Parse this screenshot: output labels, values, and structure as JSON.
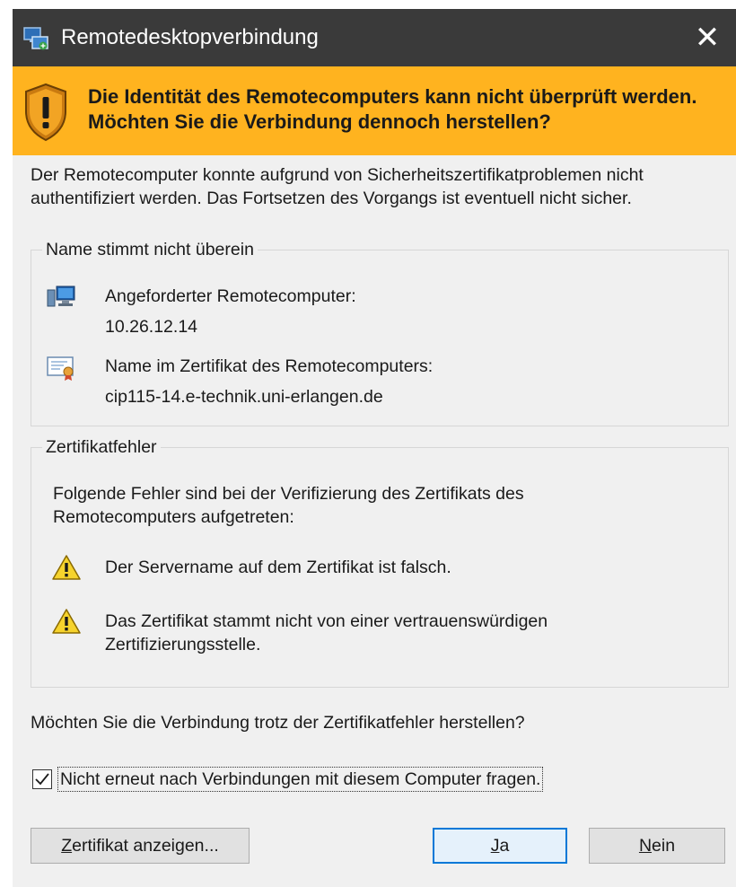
{
  "window": {
    "title": "Remotedesktopverbindung",
    "close_glyph": "✕"
  },
  "banner": {
    "text": "Die Identität des Remotecomputers kann nicht überprüft werden. Möchten Sie die Verbindung dennoch herstellen?",
    "color": "#ffb31f",
    "icon": "shield-warning-icon"
  },
  "intro": "Der Remotecomputer konnte aufgrund von Sicherheitszertifikatproblemen nicht authentifiziert werden. Das Fortsetzen des Vorgangs ist eventuell nicht sicher.",
  "name_mismatch": {
    "legend": "Name stimmt nicht überein",
    "requested_label": "Angeforderter Remotecomputer:",
    "requested_value": "10.26.12.14",
    "cert_label": "Name im Zertifikat des Remotecomputers:",
    "cert_value": "cip115-14.e-technik.uni-erlangen.de"
  },
  "cert_errors": {
    "legend": "Zertifikatfehler",
    "description": "Folgende Fehler sind bei der Verifizierung des Zertifikats des Remotecomputers aufgetreten:",
    "errors": [
      "Der Servername auf dem Zertifikat ist falsch.",
      "Das Zertifikat stammt nicht von einer vertrauenswürdigen Zertifizierungsstelle."
    ]
  },
  "question": "Möchten Sie die Verbindung trotz der Zertifikatfehler herstellen?",
  "checkbox": {
    "label": "Nicht erneut nach Verbindungen mit diesem Computer fragen.",
    "checked": true
  },
  "buttons": {
    "view_cert": {
      "label": "Zertifikat anzeigen...",
      "mnemonic": "Z",
      "rest": "ertifikat anzeigen..."
    },
    "yes": {
      "label": "Ja",
      "mnemonic": "J",
      "rest": "a"
    },
    "no": {
      "label": "Nein",
      "mnemonic": "N",
      "rest": "ein"
    }
  }
}
